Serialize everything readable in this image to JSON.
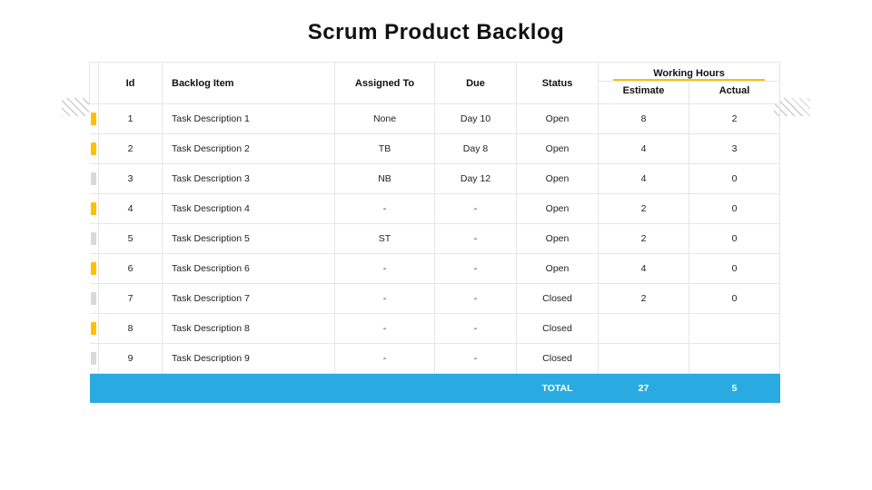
{
  "title": "Scrum Product Backlog",
  "headers": {
    "id": "Id",
    "backlog_item": "Backlog Item",
    "assigned_to": "Assigned To",
    "due": "Due",
    "status": "Status",
    "working_hours": "Working Hours",
    "estimate": "Estimate",
    "actual": "Actual"
  },
  "rows": [
    {
      "marker": "yellow",
      "id": "1",
      "item": "Task Description 1",
      "assigned": "None",
      "due": "Day 10",
      "status": "Open",
      "estimate": "8",
      "actual": "2"
    },
    {
      "marker": "yellow",
      "id": "2",
      "item": "Task Description 2",
      "assigned": "TB",
      "due": "Day 8",
      "status": "Open",
      "estimate": "4",
      "actual": "3"
    },
    {
      "marker": "gray",
      "id": "3",
      "item": "Task Description 3",
      "assigned": "NB",
      "due": "Day 12",
      "status": "Open",
      "estimate": "4",
      "actual": "0"
    },
    {
      "marker": "yellow",
      "id": "4",
      "item": "Task Description 4",
      "assigned": "-",
      "due": "-",
      "status": "Open",
      "estimate": "2",
      "actual": "0"
    },
    {
      "marker": "gray",
      "id": "5",
      "item": "Task Description 5",
      "assigned": "ST",
      "due": "-",
      "status": "Open",
      "estimate": "2",
      "actual": "0"
    },
    {
      "marker": "yellow",
      "id": "6",
      "item": "Task Description 6",
      "assigned": "-",
      "due": "-",
      "status": "Open",
      "estimate": "4",
      "actual": "0"
    },
    {
      "marker": "gray",
      "id": "7",
      "item": "Task Description 7",
      "assigned": "-",
      "due": "-",
      "status": "Closed",
      "estimate": "2",
      "actual": "0"
    },
    {
      "marker": "yellow",
      "id": "8",
      "item": "Task Description 8",
      "assigned": "-",
      "due": "-",
      "status": "Closed",
      "estimate": "",
      "actual": ""
    },
    {
      "marker": "gray",
      "id": "9",
      "item": "Task Description 9",
      "assigned": "-",
      "due": "-",
      "status": "Closed",
      "estimate": "",
      "actual": ""
    }
  ],
  "total": {
    "label": "TOTAL",
    "estimate": "27",
    "actual": "5"
  }
}
